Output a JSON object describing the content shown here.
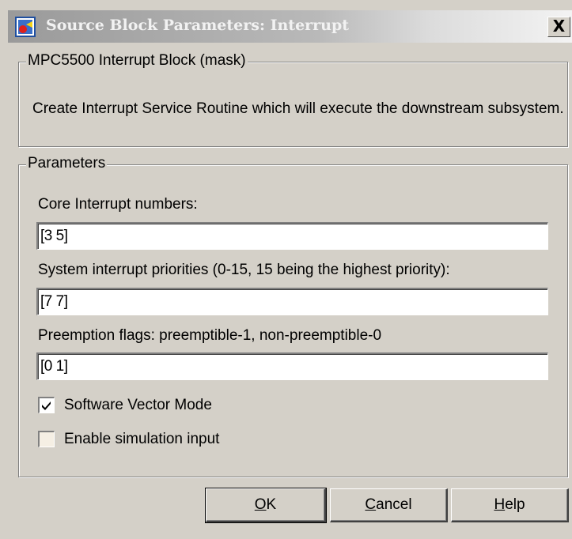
{
  "window": {
    "title": "Source Block Parameters: Interrupt",
    "close_label": "X"
  },
  "mask_group": {
    "legend": "MPC5500 Interrupt Block (mask)",
    "description": "Create Interrupt Service Routine which will execute the downstream subsystem."
  },
  "params_group": {
    "legend": "Parameters",
    "core_interrupt_label": "Core Interrupt numbers:",
    "core_interrupt_value": "[3 5]",
    "priority_label": "System interrupt priorities (0-15, 15 being the highest priority):",
    "priority_value": "[7 7]",
    "preemption_label": "Preemption flags: preemptible-1, non-preemptible-0",
    "preemption_value": "[0 1]",
    "software_vector_label": "Software Vector Mode",
    "software_vector_checked": true,
    "enable_sim_label": "Enable simulation input",
    "enable_sim_checked": false
  },
  "buttons": {
    "ok_mnemonic": "O",
    "ok_rest": "K",
    "cancel_mnemonic": "C",
    "cancel_rest": "ancel",
    "help_mnemonic": "H",
    "help_rest": "elp"
  }
}
